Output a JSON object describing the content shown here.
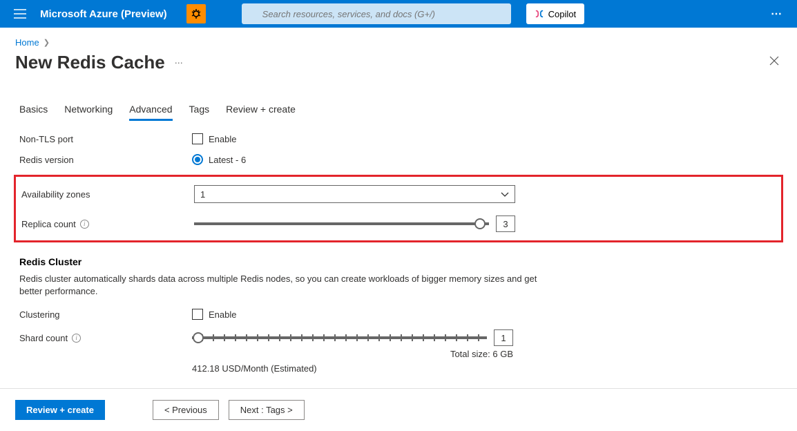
{
  "topbar": {
    "brand": "Microsoft Azure (Preview)",
    "search_placeholder": "Search resources, services, and docs (G+/)",
    "copilot_label": "Copilot"
  },
  "breadcrumb": {
    "home": "Home"
  },
  "page": {
    "title": "New Redis Cache"
  },
  "tabs": {
    "basics": "Basics",
    "networking": "Networking",
    "advanced": "Advanced",
    "tags": "Tags",
    "review": "Review + create"
  },
  "form": {
    "non_tls_label": "Non-TLS port",
    "enable_label": "Enable",
    "redis_version_label": "Redis version",
    "redis_version_value": "Latest - 6",
    "availability_zones_label": "Availability zones",
    "availability_zones_value": "1",
    "replica_count_label": "Replica count",
    "replica_count_value": "3",
    "cluster_heading": "Redis Cluster",
    "cluster_desc": "Redis cluster automatically shards data across multiple Redis nodes, so you can create workloads of bigger memory sizes and get better performance.",
    "clustering_label": "Clustering",
    "shard_count_label": "Shard count",
    "shard_count_value": "1",
    "total_size_label": "Total size: 6 GB",
    "price_label": "412.18 USD/Month (Estimated)"
  },
  "footer": {
    "review": "Review + create",
    "previous": "< Previous",
    "next": "Next : Tags >"
  }
}
